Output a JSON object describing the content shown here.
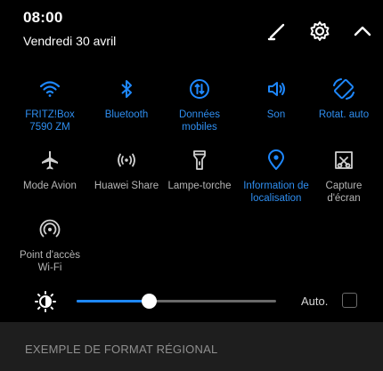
{
  "status": {
    "time": "08:00",
    "date": "Vendredi 30 avril"
  },
  "header_icons": [
    "edit-icon",
    "gear-icon",
    "chevron-up-icon"
  ],
  "colors": {
    "accent": "#1e88ff",
    "active_label": "#2f8ef0",
    "inactive_label": "#b5b5b5",
    "background": "#000000"
  },
  "tiles": [
    {
      "label": "FRITZ!Box\n7590 ZM",
      "icon": "wifi-icon",
      "active": true
    },
    {
      "label": "Bluetooth",
      "icon": "bluetooth-icon",
      "active": true
    },
    {
      "label": "Données\nmobiles",
      "icon": "mobile-data-icon",
      "active": true
    },
    {
      "label": "Son",
      "icon": "sound-icon",
      "active": true
    },
    {
      "label": "Rotat. auto",
      "icon": "auto-rotate-icon",
      "active": true
    },
    {
      "label": "Mode Avion",
      "icon": "airplane-icon",
      "active": false
    },
    {
      "label": "Huawei Share",
      "icon": "huawei-share-icon",
      "active": false
    },
    {
      "label": "Lampe-torche",
      "icon": "flashlight-icon",
      "active": false
    },
    {
      "label": "Information de\nlocalisation",
      "icon": "location-icon",
      "active": true
    },
    {
      "label": "Capture\nd'écran",
      "icon": "screenshot-icon",
      "active": false
    },
    {
      "label": "Point d'accès\nWi-Fi",
      "icon": "hotspot-icon",
      "active": false
    }
  ],
  "brightness": {
    "level": 0.36,
    "auto_label": "Auto.",
    "auto_checked": false
  },
  "region_text": "EXEMPLE DE FORMAT RÉGIONAL"
}
